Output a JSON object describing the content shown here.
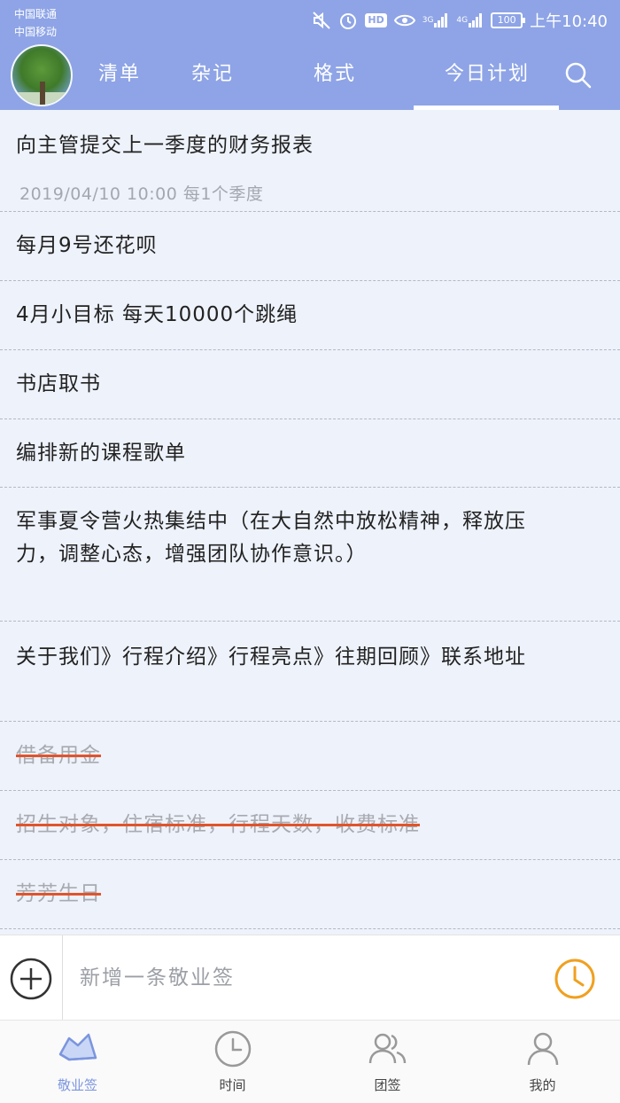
{
  "status_bar": {
    "carrier_1": "中国联通",
    "carrier_2": "中国移动",
    "hd": "HD",
    "net_1": "3G",
    "net_2": "4G",
    "battery": "100",
    "time": "上午10:40"
  },
  "header": {
    "tabs": [
      {
        "label": "清单"
      },
      {
        "label": "杂记"
      },
      {
        "label": "格式"
      },
      {
        "label": "今日计划"
      }
    ],
    "active_tab": "今日计划"
  },
  "list": {
    "items": [
      {
        "text": "向主管提交上一季度的财务报表",
        "meta": "2019/04/10  10:00 每1个季度",
        "done": false
      },
      {
        "text": "每月9号还花呗",
        "done": false
      },
      {
        "text": "4月小目标  每天10000个跳绳",
        "done": false
      },
      {
        "text": "书店取书",
        "done": false
      },
      {
        "text": "编排新的课程歌单",
        "done": false
      },
      {
        "text": "军事夏令营火热集结中（在大自然中放松精神，释放压力，调整心态，增强团队协作意识。）",
        "done": false
      },
      {
        "text": "关于我们》行程介绍》行程亮点》往期回顾》联系地址",
        "done": false
      },
      {
        "text": "借备用金",
        "done": true
      },
      {
        "text": "招生对象，住宿标准，行程天数，收费标准",
        "done": true
      },
      {
        "text": "芳芳生日",
        "done": true
      }
    ]
  },
  "input_bar": {
    "placeholder": "新增一条敬业签"
  },
  "bottom_nav": {
    "items": [
      {
        "label": "敬业签",
        "icon": "note-icon",
        "active": true
      },
      {
        "label": "时间",
        "icon": "clock-icon",
        "active": false
      },
      {
        "label": "团签",
        "icon": "group-icon",
        "active": false
      },
      {
        "label": "我的",
        "icon": "user-icon",
        "active": false
      }
    ]
  },
  "colors": {
    "header": "#8ea4e6",
    "background": "#eef2fb",
    "strike": "#e0542c",
    "clock_accent": "#f0a020",
    "active_nav": "#7b95de"
  }
}
